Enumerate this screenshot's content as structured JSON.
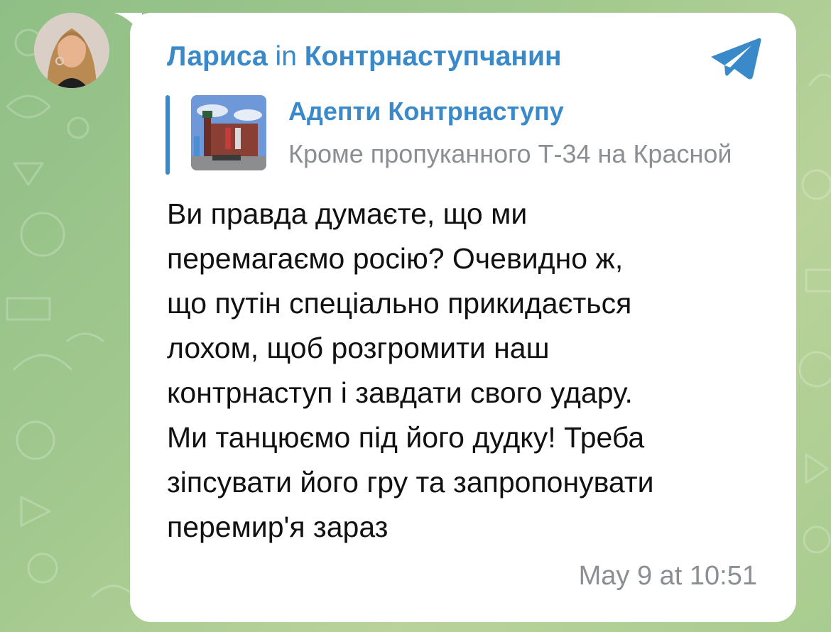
{
  "message": {
    "sender": "Лариса",
    "connector": "in",
    "channel": "Контрнаступчанин",
    "reply": {
      "title": "Адепти Контрнаступу",
      "preview": "Кроме пропуканного Т-34 на Красной"
    },
    "text": "Ви правда думаєте, що ми\nперемагаємо росію? Очевидно ж,\nщо путін спеціально прикидається\nлохом, щоб розгромити наш\nконтрнаступ і завдати свого удару.\nМи танцюємо під його дудку! Треба\nзіпсувати його гру та запропонувати\nперемир'я зараз",
    "timestamp": "May 9 at 10:51"
  },
  "icons": {
    "app": "telegram-plane-icon",
    "avatar": "user-avatar-photo",
    "thumbnail": "city-square-photo"
  },
  "colors": {
    "accent": "#3a89c9",
    "muted": "#8a8f94",
    "bubble": "#ffffff",
    "text": "#111111",
    "background": "#a3c98f"
  }
}
